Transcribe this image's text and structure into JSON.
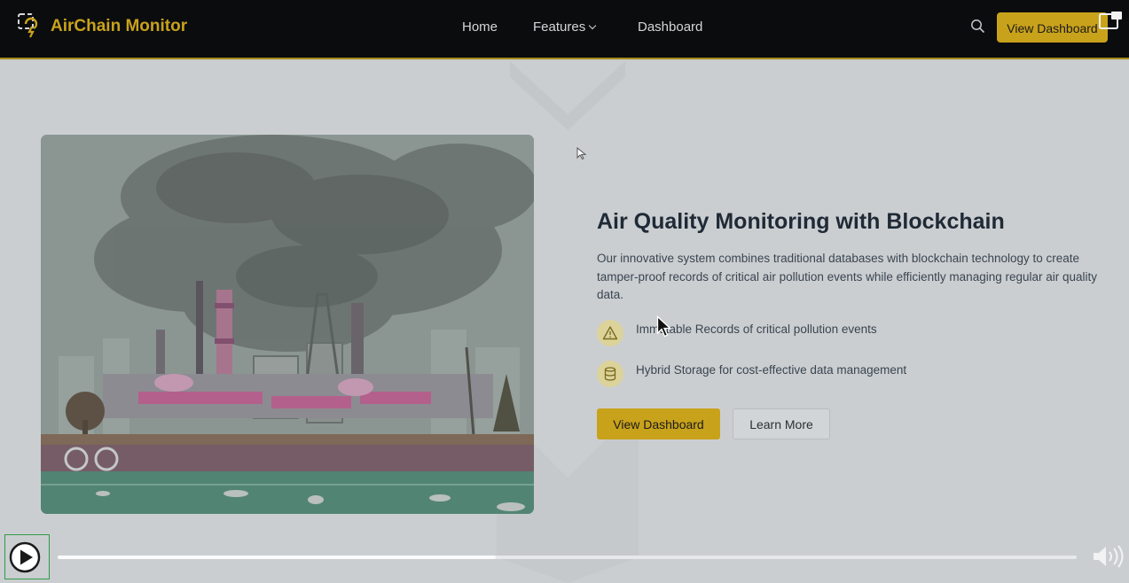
{
  "navbar": {
    "brand": "AirChain Monitor",
    "links": [
      "Home",
      "Features",
      "Dashboard"
    ],
    "cta_label": "View Dashboard",
    "icons": {
      "logo": "chain-lightning-logo-icon",
      "search": "search-icon",
      "popout": "popout-window-icon"
    }
  },
  "hero": {
    "heading": "Air Quality Monitoring with Blockchain",
    "description": "Our innovative system combines traditional databases with blockchain technology to create tamper-proof records of critical air pollution events while efficiently managing regular air quality data.",
    "features": [
      {
        "icon": "warning-icon",
        "text": "Immutable Records of critical pollution events"
      },
      {
        "icon": "database-icon",
        "text": "Hybrid Storage for cost-effective data management"
      }
    ],
    "primary_button": "View Dashboard",
    "secondary_button": "Learn More",
    "image": "industrial-pollution-illustration"
  },
  "player": {
    "progress_fraction": 0.43,
    "icons": {
      "play": "play-icon",
      "volume": "volume-icon"
    }
  },
  "colors": {
    "accent": "#c9a21b",
    "navbar_bg": "#0a0c0e",
    "page_bg": "#cbced1",
    "heading_text": "#1f2a36"
  }
}
